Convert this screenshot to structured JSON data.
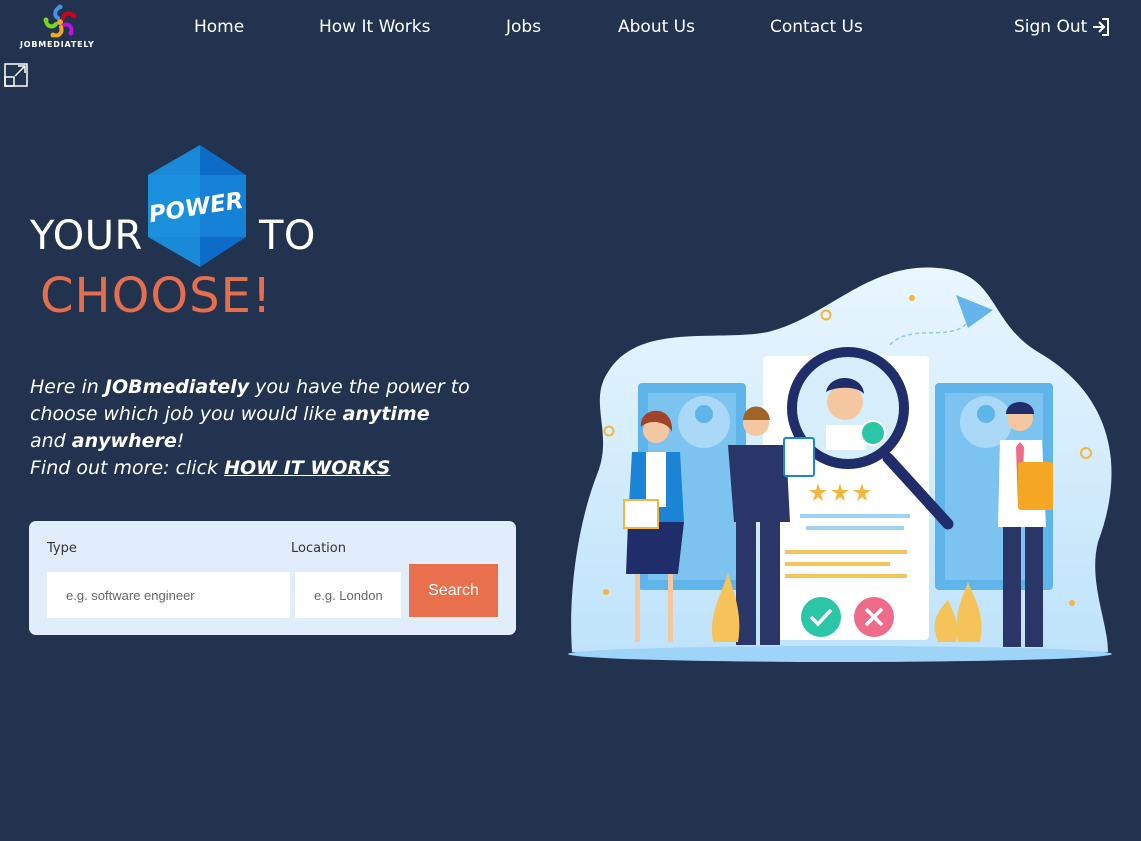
{
  "brand": {
    "name": "JOBMEDIATELY"
  },
  "nav": {
    "items": [
      "Home",
      "How It Works",
      "Jobs",
      "About Us",
      "Contact Us"
    ],
    "sign_out": "Sign Out"
  },
  "hero": {
    "word_your": "YOUR",
    "badge": "POWER",
    "word_to": "TO",
    "choose": "CHOOSE!"
  },
  "intro": {
    "p1_a": "Here in ",
    "p1_brand": "JOBmediately",
    "p1_b": " you have the power to choose which job you would like ",
    "p1_anytime": "anytime",
    "p1_c": " and ",
    "p1_anywhere": "anywhere",
    "p1_d": "!",
    "p2_a": "Find out more: click ",
    "p2_link": "HOW IT WORKS"
  },
  "search": {
    "type_label": "Type",
    "location_label": "Location",
    "type_placeholder": "e.g. software engineer",
    "location_placeholder": "e.g. London",
    "button": "Search"
  },
  "colors": {
    "background": "#21334f",
    "accent": "#e8704d",
    "card": "#e2edfb",
    "badge_blue": "#1a8ad8"
  },
  "icons": [
    "logo-icon",
    "expand-icon",
    "sign-out-icon"
  ]
}
